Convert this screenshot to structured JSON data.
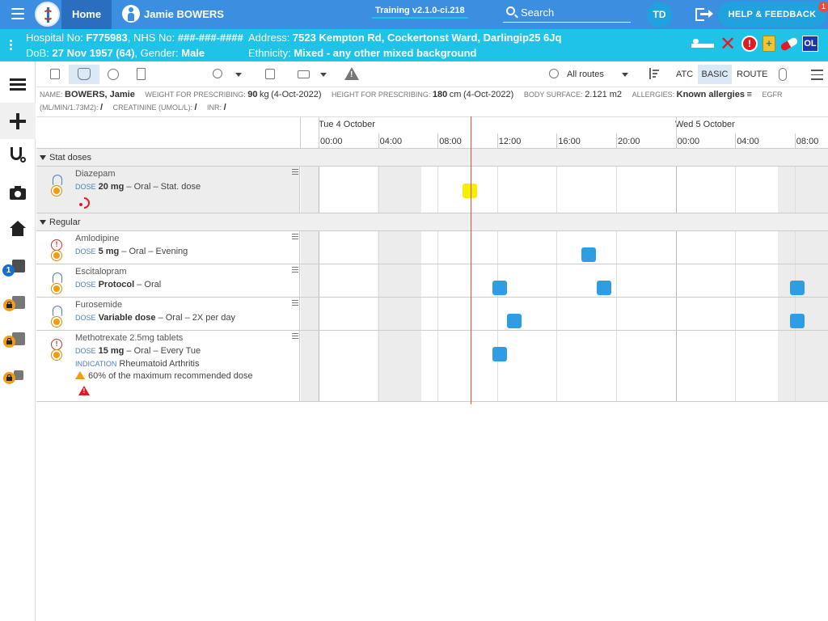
{
  "topbar": {
    "home_label": "Home",
    "patient_name": "Jamie BOWERS",
    "environment": "Training v2.1.0-ci.218",
    "search_label": "Search",
    "user_initials": "TD",
    "help_label": "HELP & FEEDBACK",
    "help_badge": "1"
  },
  "banner": {
    "hospital_label": "Hospital No: ",
    "hospital_no": "F775983",
    "nhs_label": ", NHS No: ",
    "nhs_no": "###-###-####",
    "address_label": "Address: ",
    "address": "7523 Kempton Rd, Cockertonst Ward, Darlingip25 6Jq",
    "dob_label": "DoB: ",
    "dob": "27 Nov 1957 (64)",
    "gender_label": ", Gender: ",
    "gender": "Male",
    "ethnicity_label": "Ethnicity: ",
    "ethnicity": "Mixed - any other mixed background",
    "icons": [
      "bed-icon",
      "x-icon",
      "exclamation-icon",
      "container-icon",
      "pill-icon",
      "ol-badge"
    ],
    "ol_label": "OL"
  },
  "leftnav": {
    "items": [
      "list-icon",
      "plus-icon",
      "stethoscope-icon",
      "camera-icon",
      "home-icon",
      "edit-icon",
      "clipboard-icon",
      "activity-icon",
      "add-icon"
    ],
    "edit_badge": "1"
  },
  "toolbar": {
    "routes_label": "All routes",
    "atc_label": "ATC",
    "basic_label": "BASIC",
    "route_label": "ROUTE"
  },
  "info": {
    "name_label": "NAME:",
    "name": "BOWERS, Jamie",
    "weight_label": "WEIGHT FOR PRESCRIBING:",
    "weight": "90",
    "weight_unit": "kg",
    "weight_date": "(4-Oct-2022)",
    "height_label": "HEIGHT FOR PRESCRIBING:",
    "height": "180",
    "height_unit": "cm",
    "height_date": "(4-Oct-2022)",
    "bsa_label": "BODY SURFACE:",
    "bsa": "2.121 m2",
    "allergies_label": "ALLERGIES:",
    "allergies": "Known allergies",
    "egfr_label": "EGFR",
    "egfr_unit_label": "(ML/MIN/1.73M2):",
    "egfr": "/",
    "creat_label": "CREATININE (UMOL/L):",
    "creat": "/",
    "inr_label": "INR:",
    "inr": "/"
  },
  "timeline": {
    "day1": "Tue 4 October",
    "day2": "Wed 5 October",
    "ticks": [
      "00:00",
      "04:00",
      "08:00",
      "12:00",
      "16:00",
      "20:00",
      "00:00",
      "04:00",
      "08:00"
    ],
    "sections": [
      {
        "label": "Stat doses",
        "meds": [
          {
            "name": "Diazepam",
            "dose_key": "DOSE",
            "dose_value": "20 mg",
            "dose_rest": " – Oral – Stat. dose",
            "doses_at_hours": [
              10
            ],
            "stat": true
          }
        ]
      },
      {
        "label": "Regular",
        "meds": [
          {
            "name": "Amlodipine",
            "dose_key": "DOSE",
            "dose_value": "5 mg",
            "dose_rest": " – Oral – Evening",
            "doses_at_hours": [
              18
            ]
          },
          {
            "name": "Escitalopram",
            "dose_key": "DOSE",
            "dose_value": "Protocol",
            "dose_rest": " – Oral",
            "doses_at_hours": [
              12,
              19,
              32
            ]
          },
          {
            "name": "Furosemide",
            "dose_key": "DOSE",
            "dose_value": "Variable dose",
            "dose_rest": " – Oral – 2X per day",
            "doses_at_hours": [
              13,
              32
            ]
          },
          {
            "name": "Methotrexate 2.5mg tablets",
            "dose_key": "DOSE",
            "dose_value": "15 mg",
            "dose_rest": " – Oral – Every Tue",
            "indication_key": "INDICATION",
            "indication": "Rheumatoid Arthritis",
            "warning": "60% of the maximum recommended dose",
            "doses_at_hours": [
              12
            ]
          }
        ]
      }
    ]
  }
}
